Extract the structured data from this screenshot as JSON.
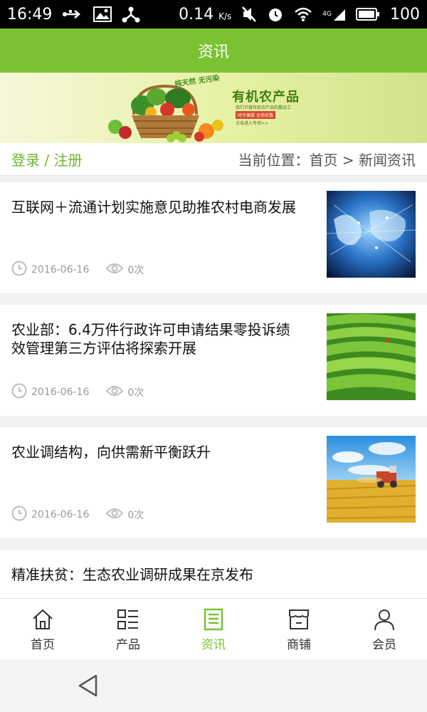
{
  "status": {
    "time": "16:49",
    "network_speed": "0.14",
    "speed_unit": "K/s",
    "signal_label": "4G",
    "battery": "100"
  },
  "header": {
    "title": "资讯"
  },
  "banner": {
    "slogan": "纯天然 无污染",
    "title": "有机农产品",
    "subtitle": "我们只做有机农产品的搬运工",
    "tag": "时令果蔬 全场优惠",
    "more": "点击进入专场>>"
  },
  "location_bar": {
    "login": "登录 / 注册",
    "location": "当前位置：首页 > 新闻资讯"
  },
  "news": [
    {
      "title": "互联网＋流通计划实施意见助推农村电商发展",
      "date": "2016-06-16",
      "views": "0次",
      "image": "globe-network"
    },
    {
      "title": "农业部：6.4万件行政许可申请结果零投诉绩效管理第三方评估将探索开展",
      "date": "2016-06-16",
      "views": "0次",
      "image": "tea-field"
    },
    {
      "title": "农业调结构，向供需新平衡跃升",
      "date": "2016-06-16",
      "views": "0次",
      "image": "wheat-harvest"
    },
    {
      "title": "精准扶贫：生态农业调研成果在京发布"
    }
  ],
  "tabs": [
    {
      "label": "首页",
      "icon": "home-icon"
    },
    {
      "label": "产品",
      "icon": "list-icon"
    },
    {
      "label": "资讯",
      "icon": "news-icon",
      "active": true
    },
    {
      "label": "商铺",
      "icon": "shop-icon"
    },
    {
      "label": "会员",
      "icon": "user-icon"
    }
  ],
  "colors": {
    "accent": "#7ac231",
    "header_bg": "#7ac231",
    "login_text": "#6fb52f"
  }
}
